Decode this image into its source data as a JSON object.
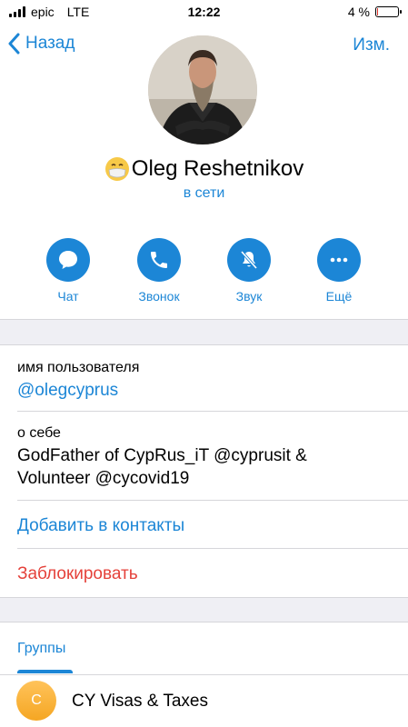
{
  "status_bar": {
    "carrier": "epic",
    "network": "LTE",
    "time": "12:22",
    "battery_percent_label": "4 %",
    "battery_level": 0.04
  },
  "nav": {
    "back_label": "Назад",
    "edit_label": "Изм."
  },
  "profile": {
    "name": "Oleg Reshetnikov",
    "status": "в сети"
  },
  "actions": [
    {
      "label": "Чат",
      "icon": "chat-bubble-icon"
    },
    {
      "label": "Звонок",
      "icon": "phone-icon"
    },
    {
      "label": "Звук",
      "icon": "bell-muted-icon"
    },
    {
      "label": "Ещё",
      "icon": "more-dots-icon"
    }
  ],
  "info": {
    "username_label": "имя пользователя",
    "username_value": "@olegcyprus",
    "about_label": "о себе",
    "about_line1": "GodFather of CypRus_iT @cyprusit &",
    "about_line2": "Volunteer @cycovid19",
    "add_contact": "Добавить в контакты",
    "block": "Заблокировать"
  },
  "groups": {
    "tab_label": "Группы",
    "items": [
      {
        "avatar_letter": "C",
        "title": "CY Visas & Taxes"
      }
    ]
  },
  "colors": {
    "accent": "#1c86d6",
    "danger": "#e5423b",
    "separator_bg": "#efeff4",
    "group_avatar": "#f5a623"
  }
}
